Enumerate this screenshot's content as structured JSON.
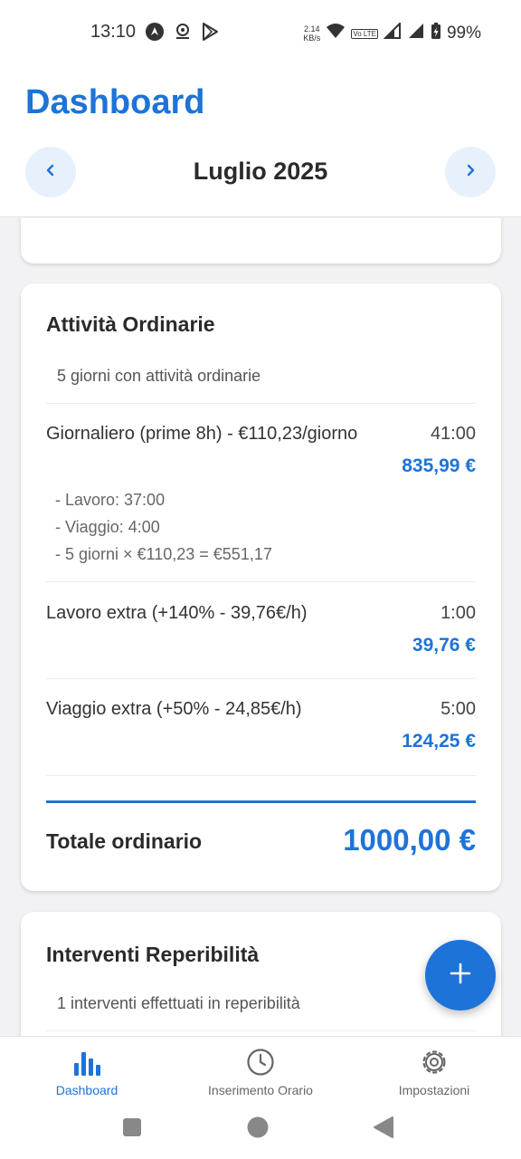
{
  "status_bar": {
    "time": "13:10",
    "net_speed_value": "2.14",
    "net_speed_unit": "KB/s",
    "volte_badge": "Vo LTE",
    "battery": "99%",
    "icons": [
      "android-auto-icon",
      "app-notification-icon",
      "play-store-icon",
      "wifi-icon",
      "signal-icon",
      "battery-charging-icon"
    ]
  },
  "header": {
    "title": "Dashboard",
    "month": "Luglio 2025",
    "prev_icon": "chevron-left-icon",
    "next_icon": "chevron-right-icon"
  },
  "ordinary_card": {
    "title": "Attività Ordinarie",
    "subtitle": "5 giorni con attività ordinarie",
    "rows": [
      {
        "label": "Giornaliero (prime 8h) - €110,23/giorno",
        "hours": "41:00",
        "amount": "835,99 €",
        "details": [
          "- Lavoro: 37:00",
          "- Viaggio: 4:00",
          "- 5 giorni × €110,23 = €551,17"
        ]
      },
      {
        "label": "Lavoro extra (+140% - 39,76€/h)",
        "hours": "1:00",
        "amount": "39,76 €"
      },
      {
        "label": "Viaggio extra (+50% - 24,85€/h)",
        "hours": "5:00",
        "amount": "124,25 €"
      }
    ],
    "total_label": "Totale ordinario",
    "total_value": "1000,00 €"
  },
  "oncall_card": {
    "title": "Interventi Reperibilità",
    "subtitle": "1 interventi effettuati in reperibilità"
  },
  "fab": {
    "icon": "plus-icon"
  },
  "bottom_nav": {
    "items": [
      {
        "label": "Dashboard",
        "icon": "bar-chart-icon",
        "active": true
      },
      {
        "label": "Inserimento Orario",
        "icon": "clock-icon",
        "active": false
      },
      {
        "label": "Impostazioni",
        "icon": "gear-icon",
        "active": false
      }
    ]
  },
  "colors": {
    "accent": "#1e73d8",
    "nav_button_bg": "#e7f1fb",
    "background": "#f2f2f5",
    "text": "#2a2a2a"
  }
}
